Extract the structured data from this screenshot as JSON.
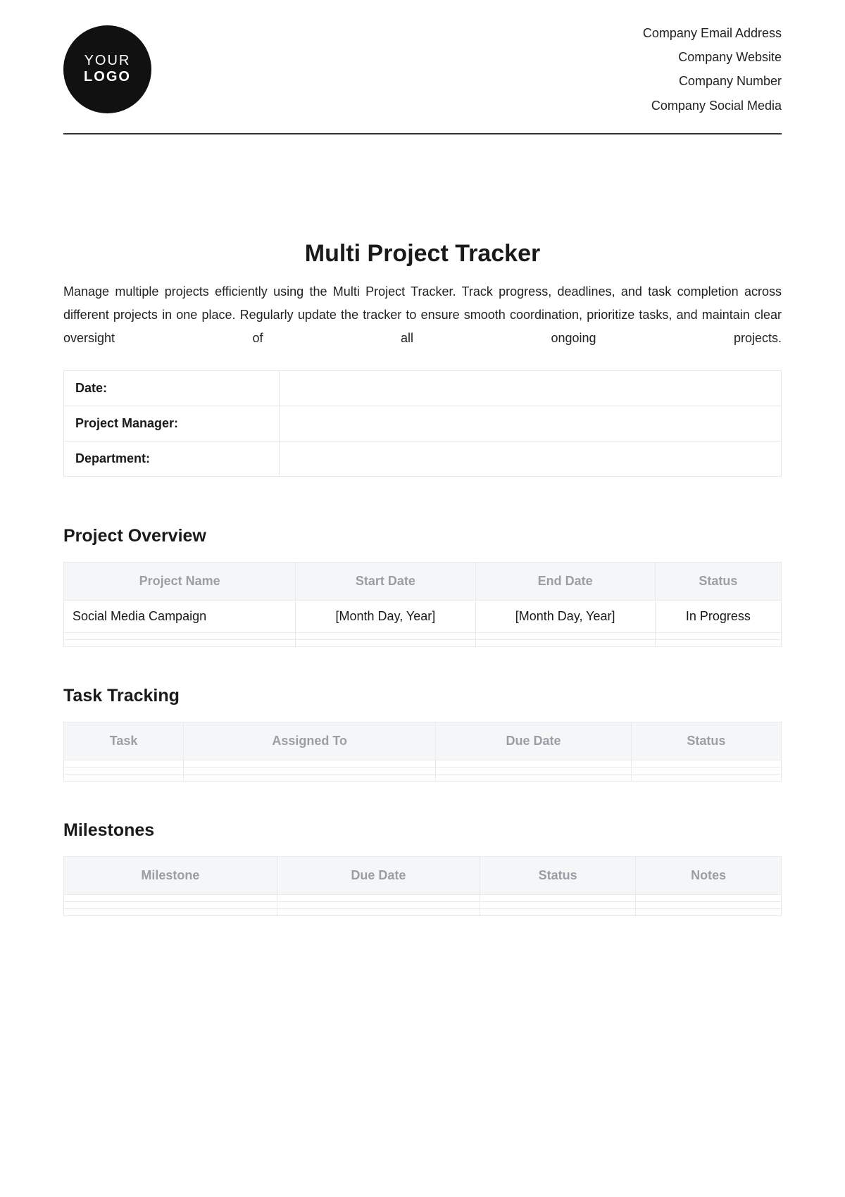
{
  "header": {
    "logo_line1": "YOUR",
    "logo_line2": "LOGO",
    "company": {
      "email": "Company Email Address",
      "website": "Company Website",
      "number": "Company Number",
      "social": "Company Social Media"
    }
  },
  "title": "Multi Project Tracker",
  "description": "Manage multiple projects efficiently using the Multi Project Tracker. Track progress, deadlines, and task completion across different projects in one place. Regularly update the tracker to ensure smooth coordination, prioritize tasks, and maintain clear oversight of all ongoing projects.",
  "info_labels": {
    "date": "Date:",
    "manager": "Project Manager:",
    "department": "Department:"
  },
  "info_values": {
    "date": "",
    "manager": "",
    "department": ""
  },
  "sections": {
    "overview": "Project Overview",
    "tasks": "Task Tracking",
    "milestones": "Milestones"
  },
  "overview": {
    "headers": {
      "name": "Project Name",
      "start": "Start Date",
      "end": "End Date",
      "status": "Status"
    },
    "rows": [
      {
        "name": "Social Media Campaign",
        "start": "[Month Day, Year]",
        "end": "[Month Day, Year]",
        "status": "In Progress"
      }
    ]
  },
  "tasks": {
    "headers": {
      "task": "Task",
      "assigned": "Assigned To",
      "due": "Due Date",
      "status": "Status"
    }
  },
  "milestones": {
    "headers": {
      "milestone": "Milestone",
      "due": "Due Date",
      "status": "Status",
      "notes": "Notes"
    }
  }
}
